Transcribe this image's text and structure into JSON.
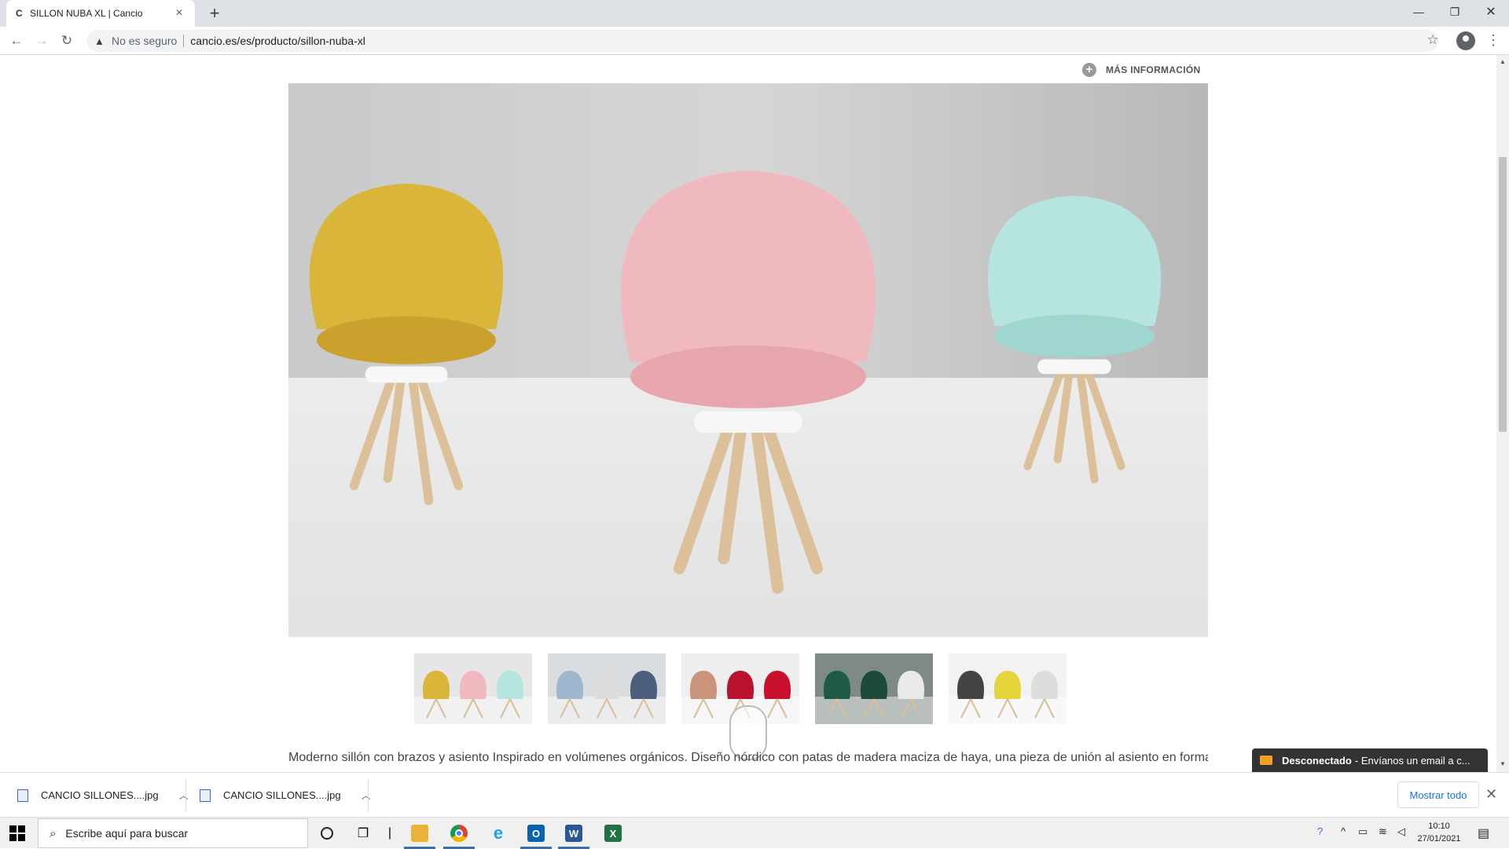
{
  "browser": {
    "tab_favicon": "C",
    "tab_title": "SILLON NUBA XL | Cancio",
    "security_label": "No es seguro",
    "url": "cancio.es/es/producto/sillon-nuba-xl"
  },
  "page": {
    "more_info": "MÁS INFORMACIÓN",
    "description": "Moderno sillón con brazos y asiento Inspirado en volúmenes orgánicos. Diseño nórdico con patas de madera maciza de haya, una pieza de unión al asiento en forma",
    "chat_status": "Desconectado",
    "chat_text": " - Envíanos un email a c..."
  },
  "hero_chairs": [
    {
      "color": "#d9b63a",
      "shade": "#c9a12c"
    },
    {
      "color": "#f0b9bf",
      "shade": "#e7a6ad"
    },
    {
      "color": "#b6e4de",
      "shade": "#9fd6cf"
    }
  ],
  "thumbnails": [
    {
      "colors": [
        "#d9b63a",
        "#f0b9bf",
        "#b6e4de"
      ],
      "bg": "#e6e6e6"
    },
    {
      "colors": [
        "#9fb6cf",
        "#dddddd",
        "#4d5e7d"
      ],
      "bg": "#d9dde0"
    },
    {
      "colors": [
        "#c9947a",
        "#b8122e",
        "#c8102e"
      ],
      "bg": "#efefef"
    },
    {
      "colors": [
        "#1f5a44",
        "#1c4a3a",
        "#e9e9e9"
      ],
      "bg": "#7f8a86"
    },
    {
      "colors": [
        "#444444",
        "#e5d53a",
        "#dddddd"
      ],
      "bg": "#f2f2f2"
    }
  ],
  "downloads": [
    {
      "name": "CANCIO SILLONES....jpg"
    },
    {
      "name": "CANCIO SILLONES....jpg"
    }
  ],
  "downloads_show_all": "Mostrar todo",
  "taskbar": {
    "search_placeholder": "Escribe aquí para buscar",
    "time": "10:10",
    "date": "27/01/2021"
  }
}
